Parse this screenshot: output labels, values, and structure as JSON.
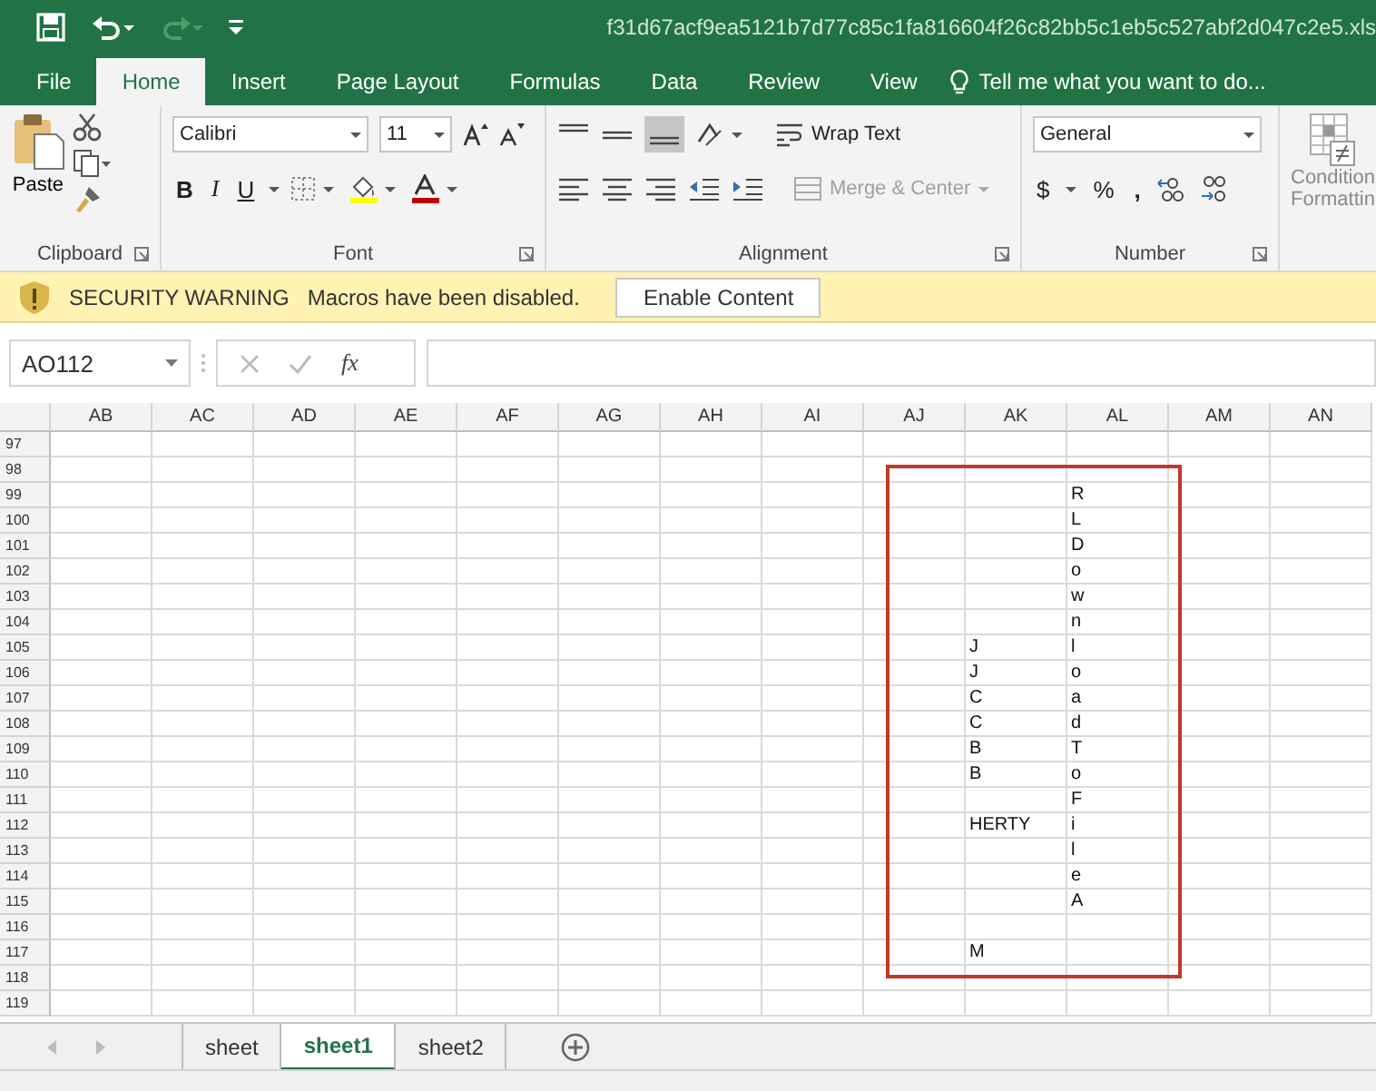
{
  "window": {
    "title": "f31d67acf9ea5121b7d77c85c1fa816604f26c82bb5c1eb5c527abf2d047c2e5.xls"
  },
  "ribbon_tabs": [
    {
      "label": "File",
      "selected": false
    },
    {
      "label": "Home",
      "selected": true
    },
    {
      "label": "Insert",
      "selected": false
    },
    {
      "label": "Page Layout",
      "selected": false
    },
    {
      "label": "Formulas",
      "selected": false
    },
    {
      "label": "Data",
      "selected": false
    },
    {
      "label": "Review",
      "selected": false
    },
    {
      "label": "View",
      "selected": false
    }
  ],
  "tell_me": "Tell me what you want to do...",
  "ribbon": {
    "paste": "Paste",
    "font_name": "Calibri",
    "font_size": "11",
    "bold": "B",
    "italic": "I",
    "underline": "U",
    "wrap_text": {
      "label": "Wrap Text",
      "disabled": false
    },
    "merge_center": {
      "label": "Merge & Center",
      "disabled": true
    },
    "number_format": "General",
    "currency": "$",
    "percent": "%",
    "comma": ",",
    "conditional": [
      "Condition",
      "Formattin"
    ],
    "groups": [
      "Clipboard",
      "Font",
      "Alignment",
      "Number"
    ]
  },
  "security_bar": {
    "title": "SECURITY WARNING",
    "message": "Macros have been disabled.",
    "button": "Enable Content"
  },
  "formula_bar": {
    "name_box": "AO112",
    "function_label": "fx"
  },
  "columns": [
    "AB",
    "AC",
    "AD",
    "AE",
    "AF",
    "AG",
    "AH",
    "AI",
    "AJ",
    "AK",
    "AL",
    "AM",
    "AN"
  ],
  "rows": [
    {
      "header": "97"
    },
    {
      "header": "98"
    },
    {
      "header": "99",
      "AL": "R"
    },
    {
      "header": "100",
      "AL": "L"
    },
    {
      "header": "101",
      "AL": "D"
    },
    {
      "header": "102",
      "AL": "o"
    },
    {
      "header": "103",
      "AL": "w"
    },
    {
      "header": "104",
      "AL": "n"
    },
    {
      "header": "105",
      "AK": "J",
      "AL": "l"
    },
    {
      "header": "106",
      "AK": "J",
      "AL": "o"
    },
    {
      "header": "107",
      "AK": "C",
      "AL": "a"
    },
    {
      "header": "108",
      "AK": "C",
      "AL": "d"
    },
    {
      "header": "109",
      "AK": "B",
      "AL": "T"
    },
    {
      "header": "110",
      "AK": "B",
      "AL": "o"
    },
    {
      "header": "111",
      "AL": "F"
    },
    {
      "header": "112",
      "AK": "HERTY",
      "AL": "i"
    },
    {
      "header": "113",
      "AL": "l"
    },
    {
      "header": "114",
      "AL": "e"
    },
    {
      "header": "115",
      "AL": "A"
    },
    {
      "header": "116"
    },
    {
      "header": "117",
      "AK": "M"
    },
    {
      "header": "118"
    },
    {
      "header": "119"
    }
  ],
  "sheets": [
    {
      "label": "sheet",
      "selected": false
    },
    {
      "label": "sheet1",
      "selected": true
    },
    {
      "label": "sheet2",
      "selected": false
    }
  ]
}
